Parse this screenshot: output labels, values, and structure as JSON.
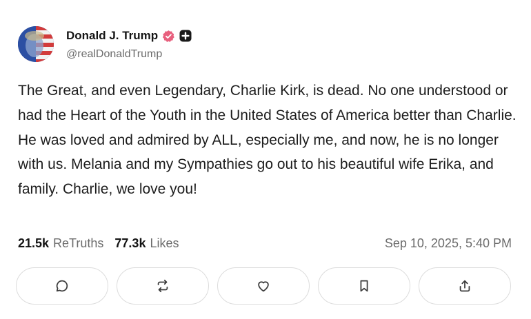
{
  "author": {
    "display_name": "Donald J. Trump",
    "handle": "@realDonaldTrump",
    "verified_badge_color": "#e8607e",
    "plus_badge_color": "#1a1a1a"
  },
  "post": {
    "text": "The Great, and even Legendary, Charlie Kirk, is dead. No one understood or had the Heart of the Youth in the United States of America better than Charlie. He was loved and admired by ALL, especially me, and now, he is no longer with us. Melania and my Sympathies go out to his beautiful wife Erika, and family. Charlie, we love you!",
    "retruths_count": "21.5k",
    "retruths_label": "ReTruths",
    "likes_count": "77.3k",
    "likes_label": "Likes",
    "timestamp": "Sep 10, 2025, 5:40 PM"
  },
  "actions": [
    {
      "icon": "comment-icon"
    },
    {
      "icon": "retruth-icon"
    },
    {
      "icon": "heart-icon"
    },
    {
      "icon": "bookmark-icon"
    },
    {
      "icon": "share-icon"
    }
  ]
}
